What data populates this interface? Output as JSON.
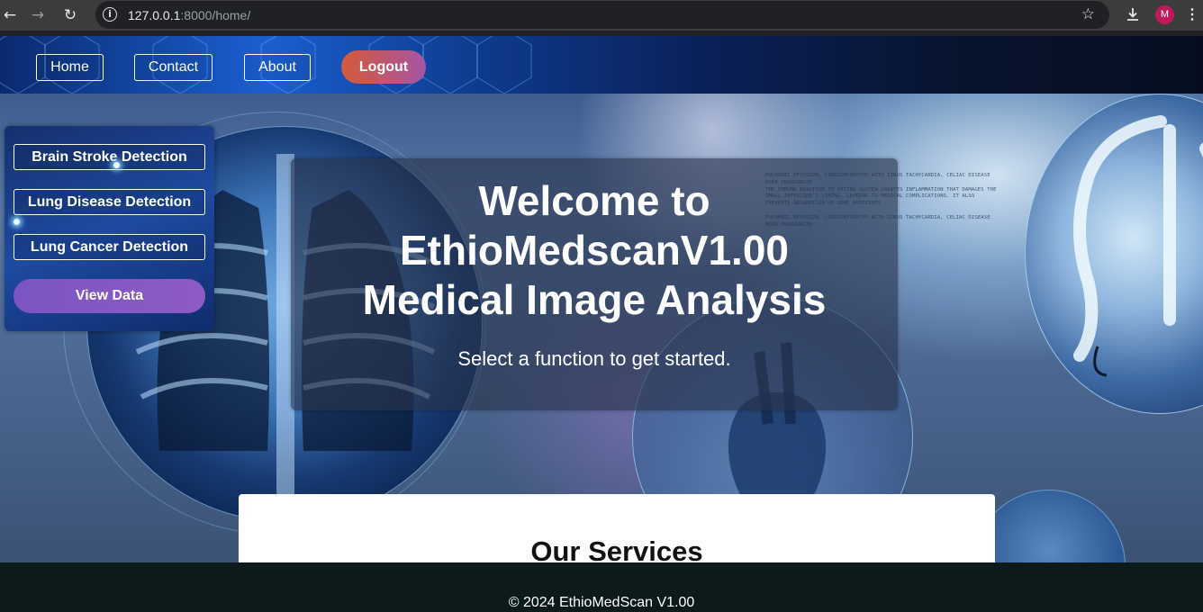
{
  "browser": {
    "url_host": "127.0.0.1",
    "url_rest": ":8000/home/",
    "profile_initial": "M",
    "icons": {
      "back": "back-arrow-icon",
      "forward": "forward-arrow-icon",
      "reload": "reload-icon",
      "info": "info-icon",
      "bookmark": "star-icon",
      "download": "download-icon",
      "menu": "kebab-menu-icon"
    }
  },
  "nav": {
    "home": "Home",
    "contact": "Contact",
    "about": "About",
    "logout": "Logout"
  },
  "sidebar": {
    "items": [
      {
        "label": "Brain Stroke Detection"
      },
      {
        "label": "Lung Disease Detection"
      },
      {
        "label": "Lung Cancer Detection"
      }
    ],
    "view_data": "View Data"
  },
  "hero": {
    "title_line1": "Welcome to",
    "title_line2": "EthioMedscanV1.00",
    "title_line3": "Medical Image Analysis",
    "subtitle": "Select a function to get started."
  },
  "services": {
    "heading": "Our Services"
  },
  "footer": {
    "copyright": "© 2024 EthioMedScan V1.00"
  },
  "colors": {
    "logout_gradient_start": "#d35a3a",
    "logout_gradient_end": "#a655a6",
    "view_data": "#7a55c2",
    "footer_bg": "#0c1a1c"
  }
}
